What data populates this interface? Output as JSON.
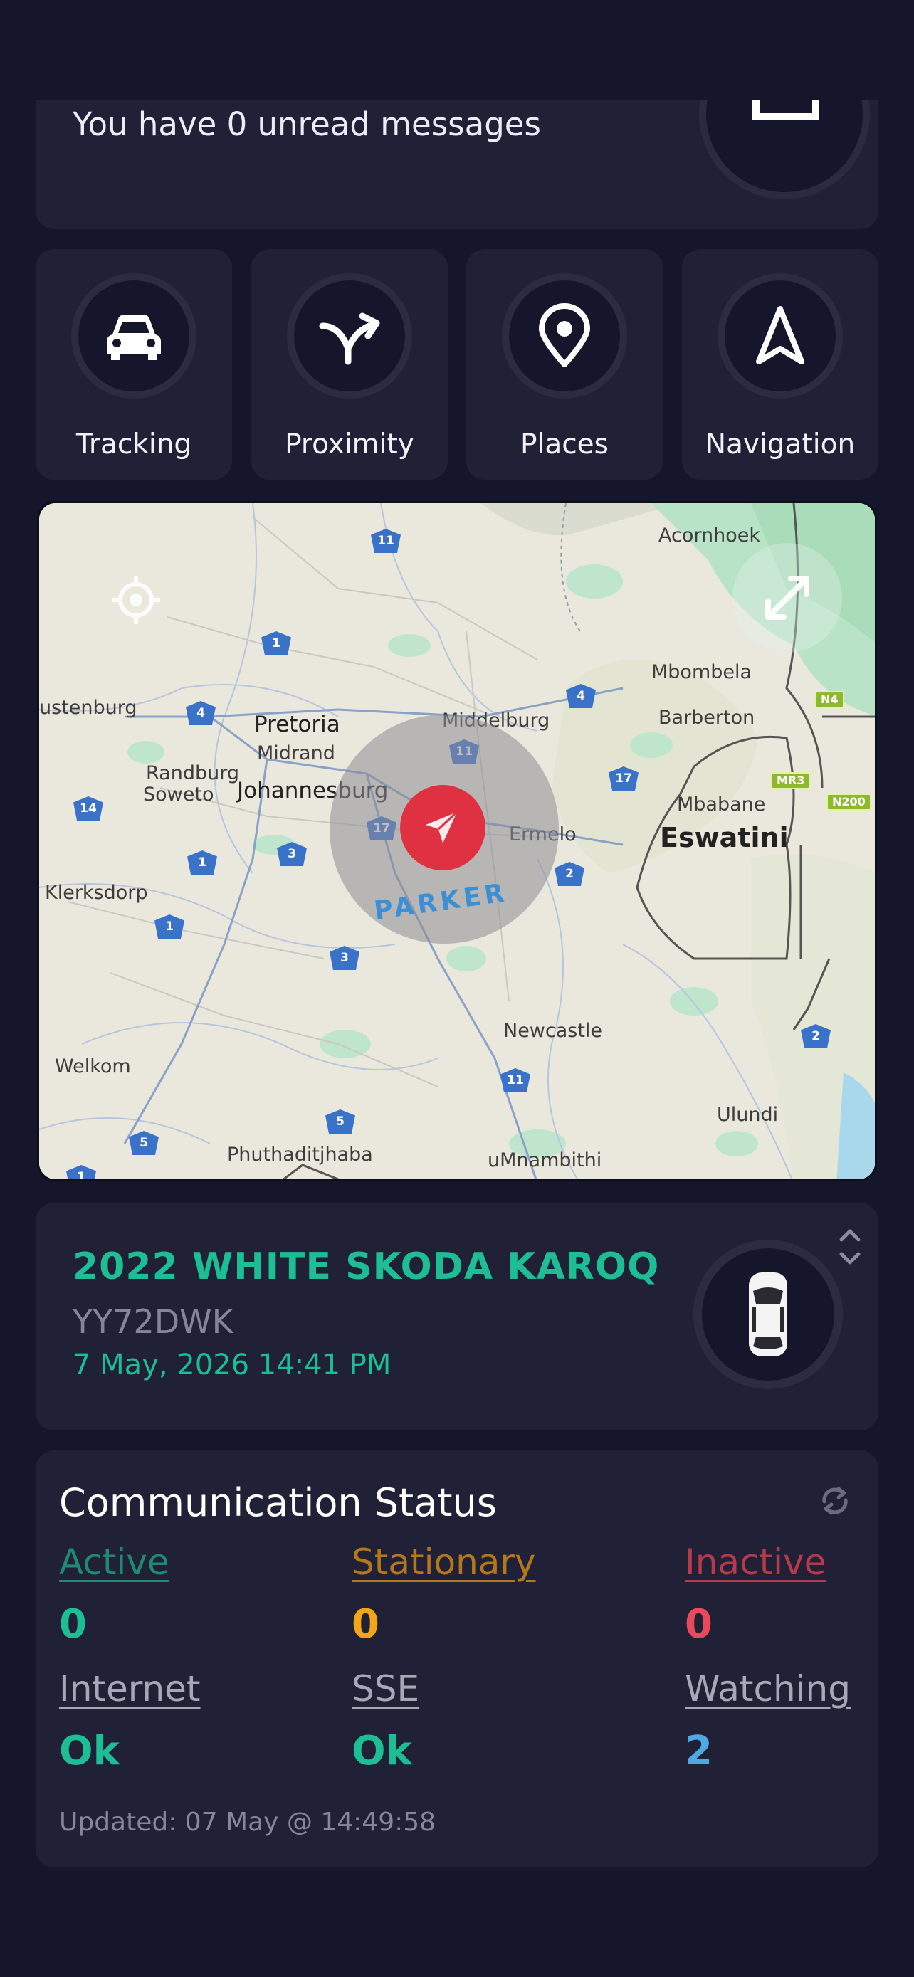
{
  "messages": {
    "text": "You have 0 unread messages",
    "icon": "message-icon"
  },
  "actions": [
    {
      "label": "Tracking",
      "icon": "car-icon"
    },
    {
      "label": "Proximity",
      "icon": "proximity-icon"
    },
    {
      "label": "Places",
      "icon": "map-pin-icon"
    },
    {
      "label": "Navigation",
      "icon": "navigation-icon"
    }
  ],
  "map": {
    "marker_label": "PARKER",
    "country": "Eswatini",
    "cities": [
      "Pretoria",
      "Midrand",
      "Randburg",
      "Soweto",
      "Johannesburg",
      "Middelburg",
      "Ermelo",
      "Mbombela",
      "Barberton",
      "Mbabane",
      "Acornhoek",
      "Klerksdorp",
      "Welkom",
      "Newcastle",
      "Ulundi",
      "Phuthaditjhaba",
      "uMnambithi",
      "ustenburg"
    ],
    "route_shields": [
      "11",
      "1",
      "4",
      "4",
      "11",
      "17",
      "14",
      "17",
      "3",
      "1",
      "2",
      "1",
      "3",
      "11",
      "2",
      "5",
      "5",
      "1"
    ],
    "green_shields": [
      "N4",
      "MR3",
      "N200"
    ]
  },
  "vehicle": {
    "title": "2022 WHITE SKODA KAROQ",
    "plate": "YY72DWK",
    "timestamp": "7 May, 2026 14:41 PM"
  },
  "comm": {
    "title": "Communication Status",
    "active_label": "Active",
    "active_value": "0",
    "stationary_label": "Stationary",
    "stationary_value": "0",
    "inactive_label": "Inactive",
    "inactive_value": "0",
    "internet_label": "Internet",
    "internet_value": "Ok",
    "sse_label": "SSE",
    "sse_value": "Ok",
    "watching_label": "Watching",
    "watching_value": "2",
    "updated": "Updated: 07 May @ 14:49:58"
  },
  "colors": {
    "accent": "#1dbe94",
    "stationary": "#f2a516",
    "inactive": "#e9495d",
    "watching": "#4ea8e2",
    "marker": "#df3142"
  }
}
